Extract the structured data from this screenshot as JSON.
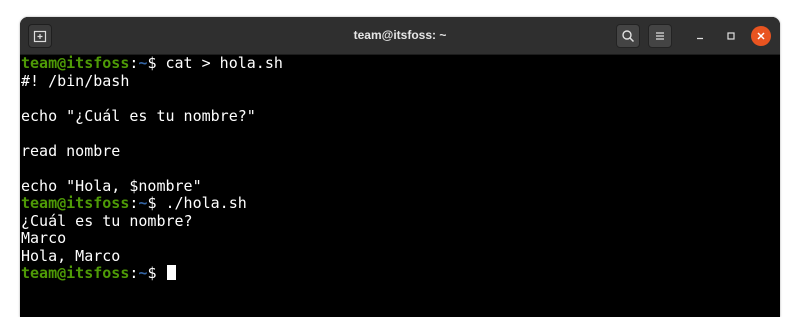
{
  "window": {
    "title": "team@itsfoss: ~"
  },
  "titlebar": {
    "new_tab_icon": "new-tab-icon",
    "search_icon": "search-icon",
    "menu_icon": "hamburger-menu-icon",
    "minimize_icon": "minimize-icon",
    "maximize_icon": "maximize-icon",
    "close_icon": "close-icon",
    "close_color": "#e95420"
  },
  "terminal": {
    "prompt_user_color": "#4e9a06",
    "prompt_path_color": "#3465a4",
    "prompt": {
      "user_host": "team@itsfoss",
      "separator": ":",
      "path": "~",
      "symbol": "$ "
    },
    "lines": [
      {
        "type": "prompt",
        "command": "cat > hola.sh"
      },
      {
        "type": "output",
        "text": "#! /bin/bash"
      },
      {
        "type": "output",
        "text": ""
      },
      {
        "type": "output",
        "text": "echo \"¿Cuál es tu nombre?\""
      },
      {
        "type": "output",
        "text": ""
      },
      {
        "type": "output",
        "text": "read nombre"
      },
      {
        "type": "output",
        "text": ""
      },
      {
        "type": "output",
        "text": "echo \"Hola, $nombre\""
      },
      {
        "type": "prompt",
        "command": "./hola.sh"
      },
      {
        "type": "output",
        "text": "¿Cuál es tu nombre?"
      },
      {
        "type": "output",
        "text": "Marco"
      },
      {
        "type": "output",
        "text": "Hola, Marco"
      },
      {
        "type": "prompt",
        "command": "",
        "cursor": true
      }
    ]
  }
}
